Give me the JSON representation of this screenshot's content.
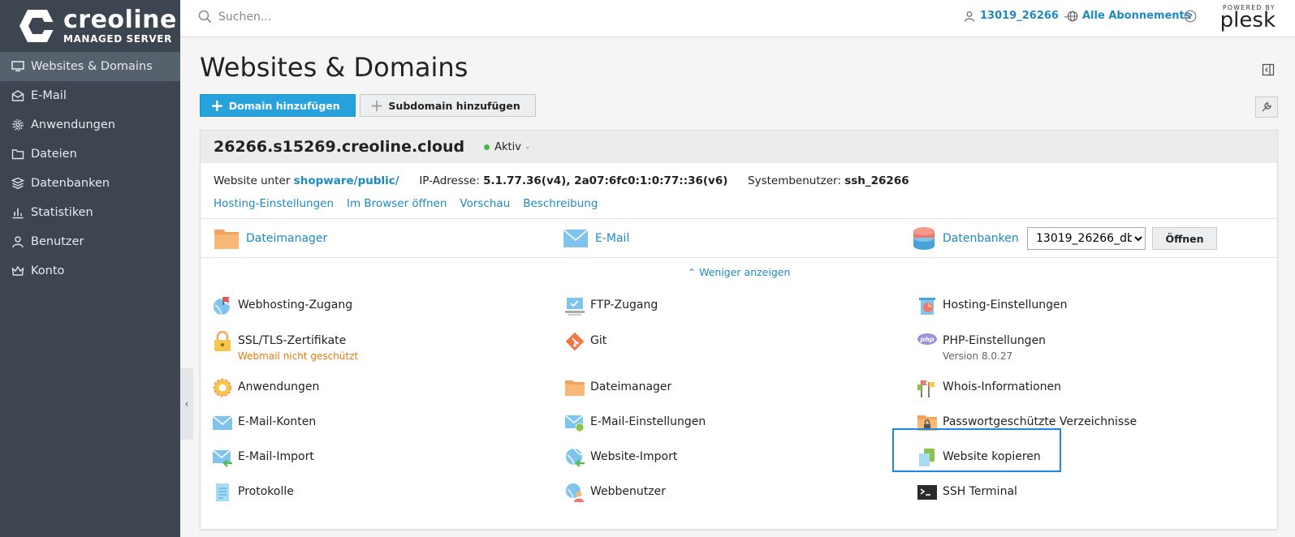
{
  "brand": {
    "name": "creoline",
    "tagline": "MANAGED SERVER"
  },
  "sidebar": {
    "items": [
      {
        "label": "Websites & Domains",
        "icon": "monitor-icon",
        "active": true
      },
      {
        "label": "E-Mail",
        "icon": "envelope-icon"
      },
      {
        "label": "Anwendungen",
        "icon": "gear-icon"
      },
      {
        "label": "Dateien",
        "icon": "folder-icon"
      },
      {
        "label": "Datenbanken",
        "icon": "database-icon"
      },
      {
        "label": "Statistiken",
        "icon": "bar-chart-icon"
      },
      {
        "label": "Benutzer",
        "icon": "user-icon"
      },
      {
        "label": "Konto",
        "icon": "crown-icon"
      }
    ]
  },
  "header": {
    "search_placeholder": "Suchen...",
    "user": "13019_26266",
    "subscriptions": "Alle Abonnements",
    "powered_by": "POWERED BY",
    "plesk": "plesk"
  },
  "main": {
    "title": "Websites & Domains",
    "add_domain": "Domain hinzufügen",
    "add_subdomain": "Subdomain hinzufügen",
    "domain": {
      "name": "26266.s15269.creoline.cloud",
      "status": "Aktiv",
      "website_label": "Website unter",
      "website_path": "shopware/public/",
      "ip_label": "IP-Adresse:",
      "ip_value": "5.1.77.36(v4), 2a07:6fc0:1:0:77::36(v6)",
      "sysuser_label": "Systembenutzer:",
      "sysuser_value": "ssh_26266",
      "links": [
        "Hosting-Einstellungen",
        "Im Browser öffnen",
        "Vorschau",
        "Beschreibung"
      ],
      "quick": {
        "filemanager": "Dateimanager",
        "email": "E-Mail",
        "databases": "Datenbanken",
        "db_selected": "13019_26266_db",
        "open": "Öffnen"
      },
      "show_less": "Weniger anzeigen",
      "tools": [
        {
          "label": "Webhosting-Zugang",
          "icon": "webhosting-icon"
        },
        {
          "label": "FTP-Zugang",
          "icon": "ftp-icon"
        },
        {
          "label": "Hosting-Einstellungen",
          "icon": "hosting-settings-icon"
        },
        {
          "label": "SSL/TLS-Zertifikate",
          "icon": "lock-icon",
          "sub": "Webmail nicht geschützt"
        },
        {
          "label": "Git",
          "icon": "git-icon"
        },
        {
          "label": "PHP-Einstellungen",
          "icon": "php-icon",
          "sub": "Version 8.0.27"
        },
        {
          "label": "Anwendungen",
          "icon": "gear-icon"
        },
        {
          "label": "Dateimanager",
          "icon": "folder-icon"
        },
        {
          "label": "Whois-Informationen",
          "icon": "flags-icon"
        },
        {
          "label": "E-Mail-Konten",
          "icon": "envelope-icon"
        },
        {
          "label": "E-Mail-Einstellungen",
          "icon": "mail-settings-icon"
        },
        {
          "label": "Passwortgeschützte Verzeichnisse",
          "icon": "locked-folder-icon"
        },
        {
          "label": "E-Mail-Import",
          "icon": "mail-import-icon"
        },
        {
          "label": "Website-Import",
          "icon": "website-import-icon"
        },
        {
          "label": "Website kopieren",
          "icon": "copy-website-icon"
        },
        {
          "label": "Protokolle",
          "icon": "logs-icon"
        },
        {
          "label": "Webbenutzer",
          "icon": "web-user-icon"
        },
        {
          "label": "SSH Terminal",
          "icon": "terminal-icon"
        }
      ]
    }
  }
}
